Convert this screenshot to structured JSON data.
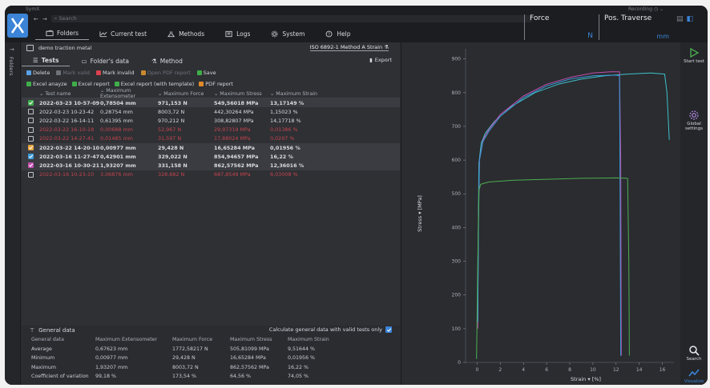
{
  "app": {
    "title": "SymX",
    "search_placeholder": "Search",
    "recording_label": "Recording",
    "menu": [
      {
        "label": "Folders",
        "icon": "folder-icon"
      },
      {
        "label": "Current test",
        "icon": "chart-icon"
      },
      {
        "label": "Methods",
        "icon": "flask-icon"
      },
      {
        "label": "Logs",
        "icon": "logs-icon"
      },
      {
        "label": "System",
        "icon": "gear-icon"
      },
      {
        "label": "Help",
        "icon": "help-icon"
      }
    ],
    "readouts": [
      {
        "label": "Force",
        "unit": "N"
      },
      {
        "label": "Pos. Traverse",
        "unit": "mm"
      }
    ]
  },
  "left_strip": {
    "label": "Folders"
  },
  "main": {
    "folder_name": "demo traction metal",
    "method_name": "ISO 6892-1 Method A Strain",
    "tabs": [
      "Tests",
      "Folder's data",
      "Method"
    ],
    "export_label": "Export",
    "toolbar1": [
      {
        "label": "Delete",
        "enabled": true,
        "color": "#5aa0e6"
      },
      {
        "label": "Mark valid",
        "enabled": false,
        "color": "#6e737a"
      },
      {
        "label": "Mark invalid",
        "enabled": true,
        "color": "#d9434f"
      },
      {
        "label": "Open PDF report",
        "enabled": false,
        "color": "#c98a2e"
      },
      {
        "label": "Save",
        "enabled": true,
        "color": "#3fae4a"
      }
    ],
    "toolbar2": [
      {
        "label": "Excel anayze",
        "color": "#3fae4a"
      },
      {
        "label": "Excel report",
        "color": "#3fae4a"
      },
      {
        "label": "Excel report (with template)",
        "color": "#3fae4a"
      },
      {
        "label": "PDF report",
        "color": "#e08a2a"
      }
    ],
    "columns": [
      "Test name",
      "Maximum Extensometer",
      "Maximum Force",
      "Maximum Stress",
      "Maximum Strain"
    ],
    "rows": [
      {
        "check": "#3fae4a",
        "bold": true,
        "invalid": false,
        "cells": [
          "2022-03-23 10-57-09",
          "0,78504 mm",
          "971,153 N",
          "549,56018 MPa",
          "13,17149 %"
        ]
      },
      {
        "check": null,
        "bold": false,
        "invalid": false,
        "cells": [
          "2022-03-23 10-23-42",
          "0,28754 mm",
          "8003,72 N",
          "442,30264 MPa",
          "1,15023 %"
        ]
      },
      {
        "check": null,
        "bold": false,
        "invalid": false,
        "cells": [
          "2022-03-22 16-14-11",
          "0,61395 mm",
          "970,212 N",
          "308,82807 MPa",
          "14,17718 %"
        ]
      },
      {
        "check": null,
        "bold": false,
        "invalid": true,
        "cells": [
          "2022-03-22 16-10-18",
          "0,00688 mm",
          "52,967 N",
          "29,97319 MPa",
          "0,01386 %"
        ]
      },
      {
        "check": null,
        "bold": false,
        "invalid": true,
        "cells": [
          "2022-03-22 14-27-41",
          "0,01485 mm",
          "31,597 N",
          "17,88024 MPa",
          "0,0297 %"
        ]
      },
      {
        "check": "#e8a23a",
        "bold": true,
        "invalid": false,
        "cells": [
          "2022-03-22 14-20-10",
          "0,00977 mm",
          "29,428 N",
          "16,65284 MPa",
          "0,01956 %"
        ]
      },
      {
        "check": "#3b9ad9",
        "bold": true,
        "invalid": false,
        "cells": [
          "2022-03-16 11-27-47",
          "0,42901 mm",
          "329,022 N",
          "854,94657 MPa",
          "16,22 %"
        ]
      },
      {
        "check": "#c34fb0",
        "bold": true,
        "invalid": false,
        "cells": [
          "2022-03-16 10-30-21",
          "1,93207 mm",
          "331,158 N",
          "862,57562 MPa",
          "12,36016 %"
        ]
      },
      {
        "check": null,
        "bold": false,
        "invalid": true,
        "cells": [
          "2022-03-16 10-23-10",
          "3,06876 mm",
          "328,682 N",
          "687,8549 MPa",
          "6,03008 %"
        ]
      }
    ],
    "general": {
      "title": "General data",
      "calc_label": "Calculate general data with valid tests only",
      "columns": [
        "General data",
        "Maximum Extensometer",
        "Maximum Force",
        "Maximum Stress",
        "Maximum Strain"
      ],
      "rows": [
        [
          "Average",
          "0,67623 mm",
          "1772,58217 N",
          "505,81099 MPa",
          "9,51644 %"
        ],
        [
          "Minimum",
          "0,00977 mm",
          "29,428 N",
          "16,65284 MPa",
          "0,01956 %"
        ],
        [
          "Maximum",
          "1,93207 mm",
          "8003,72 N",
          "862,57562 MPa",
          "16,22 %"
        ],
        [
          "Coefficient of variation",
          "99,18 %",
          "173,54 %",
          "64,56 %",
          "74,05 %"
        ]
      ]
    }
  },
  "chart_data": {
    "type": "line",
    "xlabel": "Strain",
    "xunit": "[%]",
    "ylabel": "Stress",
    "yunit": "[MPa]",
    "xlim": [
      -1,
      17
    ],
    "ylim": [
      0,
      930
    ],
    "xticks": [
      0,
      2,
      4,
      6,
      8,
      10,
      12,
      14,
      16
    ],
    "yticks": [
      0,
      100,
      200,
      300,
      400,
      500,
      600,
      700,
      800,
      900
    ],
    "grid": false,
    "series": [
      {
        "color": "#3ec1c9",
        "points": [
          [
            0.05,
            120
          ],
          [
            0.1,
            400
          ],
          [
            0.15,
            590
          ],
          [
            0.35,
            650
          ],
          [
            0.7,
            680
          ],
          [
            1.5,
            715
          ],
          [
            3,
            760
          ],
          [
            5,
            800
          ],
          [
            7,
            825
          ],
          [
            9,
            840
          ],
          [
            11,
            850
          ],
          [
            13,
            855
          ],
          [
            15,
            858
          ],
          [
            16.2,
            855
          ],
          [
            16.4,
            800
          ],
          [
            16.6,
            660
          ]
        ]
      },
      {
        "color": "#c34fb0",
        "points": [
          [
            0.05,
            100
          ],
          [
            0.1,
            380
          ],
          [
            0.2,
            600
          ],
          [
            0.5,
            660
          ],
          [
            1,
            690
          ],
          [
            2,
            735
          ],
          [
            4,
            790
          ],
          [
            6,
            825
          ],
          [
            8,
            845
          ],
          [
            10,
            858
          ],
          [
            11.5,
            862
          ],
          [
            12.3,
            862
          ],
          [
            12.4,
            600
          ],
          [
            12.45,
            20
          ]
        ]
      },
      {
        "color": "#3b9ad9",
        "points": [
          [
            0.05,
            120
          ],
          [
            0.12,
            420
          ],
          [
            0.2,
            600
          ],
          [
            0.5,
            655
          ],
          [
            1,
            685
          ],
          [
            2,
            730
          ],
          [
            4,
            785
          ],
          [
            6,
            820
          ],
          [
            8,
            840
          ],
          [
            10,
            850
          ],
          [
            12,
            852
          ],
          [
            12.3,
            850
          ],
          [
            12.35,
            500
          ],
          [
            12.4,
            20
          ]
        ]
      },
      {
        "color": "#4caf50",
        "points": [
          [
            -0.05,
            10
          ],
          [
            0.05,
            300
          ],
          [
            0.15,
            510
          ],
          [
            0.3,
            528
          ],
          [
            1,
            535
          ],
          [
            3,
            540
          ],
          [
            6,
            543
          ],
          [
            9,
            546
          ],
          [
            12,
            547
          ],
          [
            13,
            546
          ],
          [
            13.1,
            300
          ],
          [
            13.15,
            20
          ]
        ]
      }
    ]
  },
  "right_strip": {
    "items": [
      {
        "label": "Start test",
        "icon": "play-icon"
      },
      {
        "label": "Global settings",
        "icon": "gear-icon"
      },
      {
        "label": "Search",
        "icon": "search-icon"
      },
      {
        "label": "Visualize",
        "icon": "visualize-icon"
      }
    ]
  }
}
